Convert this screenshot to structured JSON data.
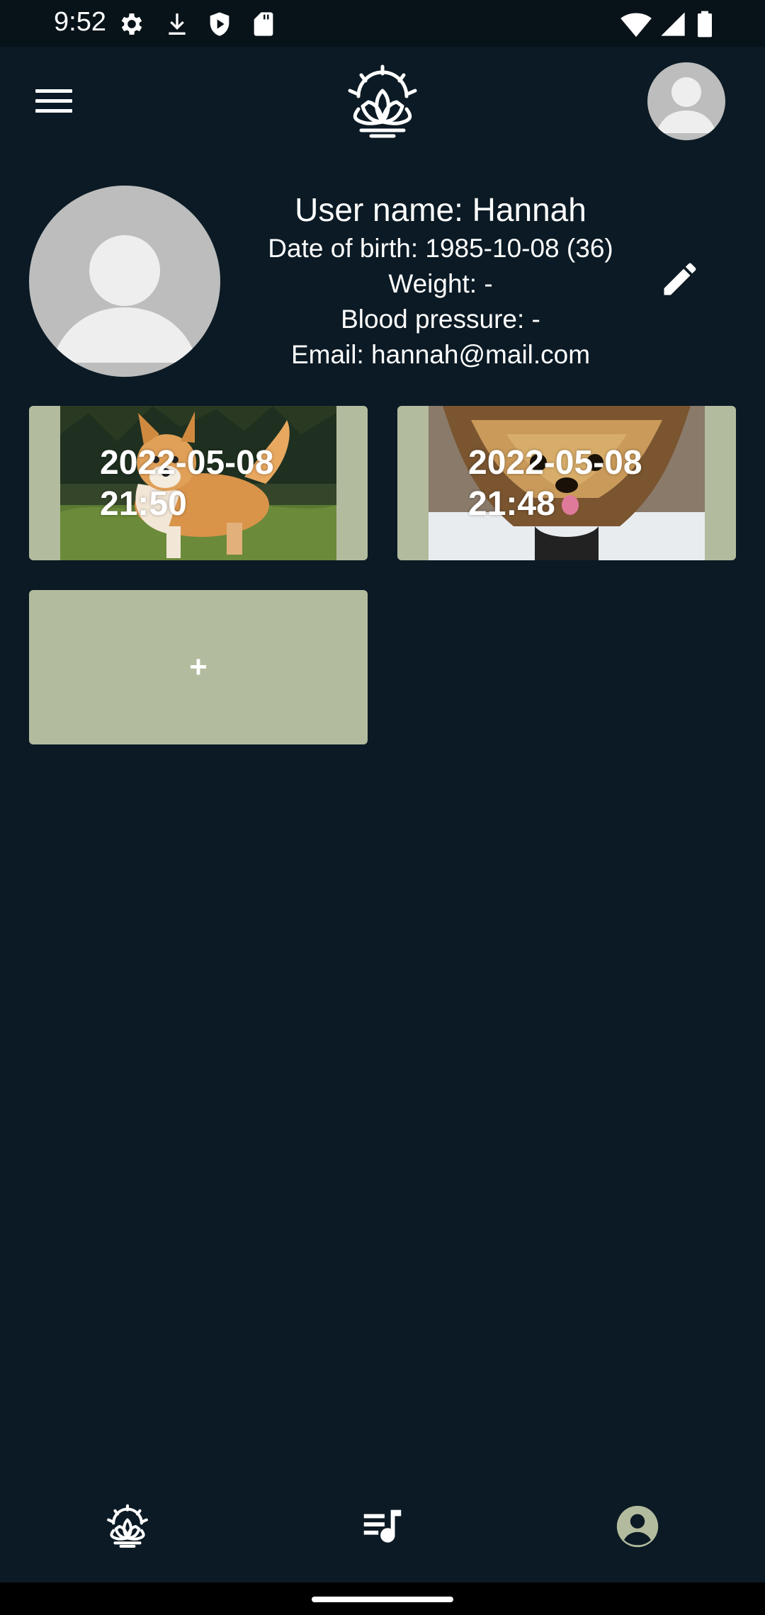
{
  "status_bar": {
    "time": "9:52",
    "icons": [
      "settings-icon",
      "download-icon",
      "shield-icon",
      "sd-card-icon",
      "wifi-icon",
      "signal-icon",
      "battery-icon"
    ]
  },
  "app_bar": {
    "menu_icon": "hamburger-menu-icon",
    "logo_icon": "lotus-sunrise-icon",
    "avatar_icon": "default-avatar-icon"
  },
  "profile": {
    "username_line": "User name: Hannah",
    "dob_line": "Date of birth: 1985-10-08 (36)",
    "weight_line": "Weight: -",
    "blood_pressure_line": "Blood pressure: -",
    "email_line": "Email: hannah@mail.com",
    "edit_icon": "pencil-icon"
  },
  "entries": [
    {
      "date": "2022-05-08",
      "time": "21:50",
      "photo": "corgi-photo"
    },
    {
      "date": "2022-05-08",
      "time": "21:48",
      "photo": "yorkie-photo"
    }
  ],
  "add_entry_label": "+",
  "bottom_nav": {
    "items": [
      {
        "icon": "lotus-sunrise-icon",
        "name": "meditate"
      },
      {
        "icon": "playlist-music-icon",
        "name": "playlist"
      },
      {
        "icon": "account-circle-icon",
        "name": "account"
      }
    ]
  },
  "colors": {
    "background": "#0B1A24",
    "card": "#B3BB9E",
    "avatar": "#BDBDBD",
    "nav_active": "#B3BB9E"
  }
}
